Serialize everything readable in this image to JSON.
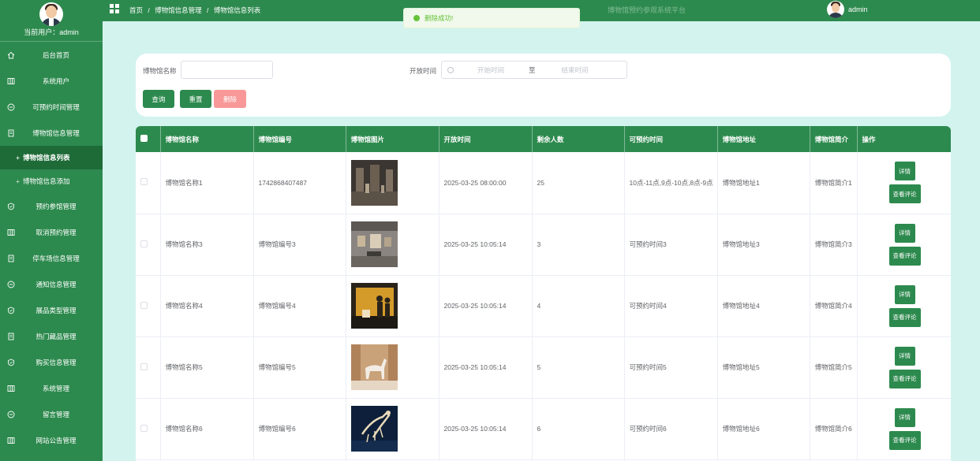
{
  "sidebar": {
    "current_user": "当前用户：admin",
    "menu": [
      {
        "label": "后台首页",
        "icon": "home-icon"
      },
      {
        "label": "系统用户",
        "icon": "grid-icon"
      },
      {
        "label": "可预约时间管理",
        "icon": "chat-icon"
      },
      {
        "label": "博物馆信息管理",
        "icon": "doc-icon"
      }
    ],
    "submenu": [
      {
        "label": "博物馆信息列表",
        "active": true
      },
      {
        "label": "博物馆信息添加",
        "active": false
      }
    ],
    "menu2": [
      {
        "label": "预约参馆管理",
        "icon": "shield-icon"
      },
      {
        "label": "取消预约管理",
        "icon": "grid-icon"
      },
      {
        "label": "停车场信息管理",
        "icon": "doc-icon"
      },
      {
        "label": "通知信息管理",
        "icon": "chat-icon"
      },
      {
        "label": "展品类型管理",
        "icon": "shield-icon"
      },
      {
        "label": "热门藏品管理",
        "icon": "doc-icon"
      },
      {
        "label": "购买信息管理",
        "icon": "shield-icon"
      },
      {
        "label": "系统管理",
        "icon": "grid-icon"
      },
      {
        "label": "留言管理",
        "icon": "chat-icon"
      },
      {
        "label": "网站公告管理",
        "icon": "grid-icon"
      }
    ]
  },
  "topbar": {
    "breadcrumb": [
      "首页",
      "/",
      "博物馆信息管理",
      "/",
      "博物馆信息列表"
    ],
    "system_title": "博物馆预约参观系统平台",
    "username": "admin"
  },
  "toast": {
    "message": "删除成功!"
  },
  "search": {
    "name_label": "博物馆名称",
    "name_value": "",
    "time_label": "开放时间",
    "start_placeholder": "开始时间",
    "range_sep": "至",
    "end_placeholder": "结束时间",
    "query_btn": "查询",
    "reset_btn": "重置",
    "delete_btn": "删除"
  },
  "table": {
    "columns": [
      "博物馆名称",
      "博物馆编号",
      "博物馆图片",
      "开放时间",
      "剩余人数",
      "可预约时间",
      "博物馆地址",
      "博物馆简介",
      "操作"
    ],
    "detail_btn": "详情",
    "review_btn": "查看评论",
    "rows": [
      {
        "name": "博物馆名称1",
        "code": "1742868407487",
        "image": "gallery-hall",
        "open_time": "2025-03-25 08:00:00",
        "remaining": "25",
        "slots": "10点-11点,9点-10点,8点-9点",
        "address": "博物馆地址1",
        "intro": "博物馆简介1"
      },
      {
        "name": "博物馆名称3",
        "code": "博物馆编号3",
        "image": "exhibit-wall",
        "open_time": "2025-03-25 10:05:14",
        "remaining": "3",
        "slots": "可预约时间3",
        "address": "博物馆地址3",
        "intro": "博物馆简介3"
      },
      {
        "name": "博物馆名称4",
        "code": "博物馆编号4",
        "image": "visitors-gold",
        "open_time": "2025-03-25 10:05:14",
        "remaining": "4",
        "slots": "可预约时间4",
        "address": "博物馆地址4",
        "intro": "博物馆简介4"
      },
      {
        "name": "博物馆名称5",
        "code": "博物馆编号5",
        "image": "horse-statue",
        "open_time": "2025-03-25 10:05:14",
        "remaining": "5",
        "slots": "可预约时间5",
        "address": "博物馆地址5",
        "intro": "博物馆简介5"
      },
      {
        "name": "博物馆名称6",
        "code": "博物馆编号6",
        "image": "skeleton-blue",
        "open_time": "2025-03-25 10:05:14",
        "remaining": "6",
        "slots": "可预约时间6",
        "address": "博物馆地址6",
        "intro": "博物馆简介6"
      }
    ]
  },
  "colors": {
    "primary": "#2d8a4e",
    "active_menu": "#1e6b38",
    "danger_light": "#f89898",
    "page_bg": "#d3f3ef"
  }
}
